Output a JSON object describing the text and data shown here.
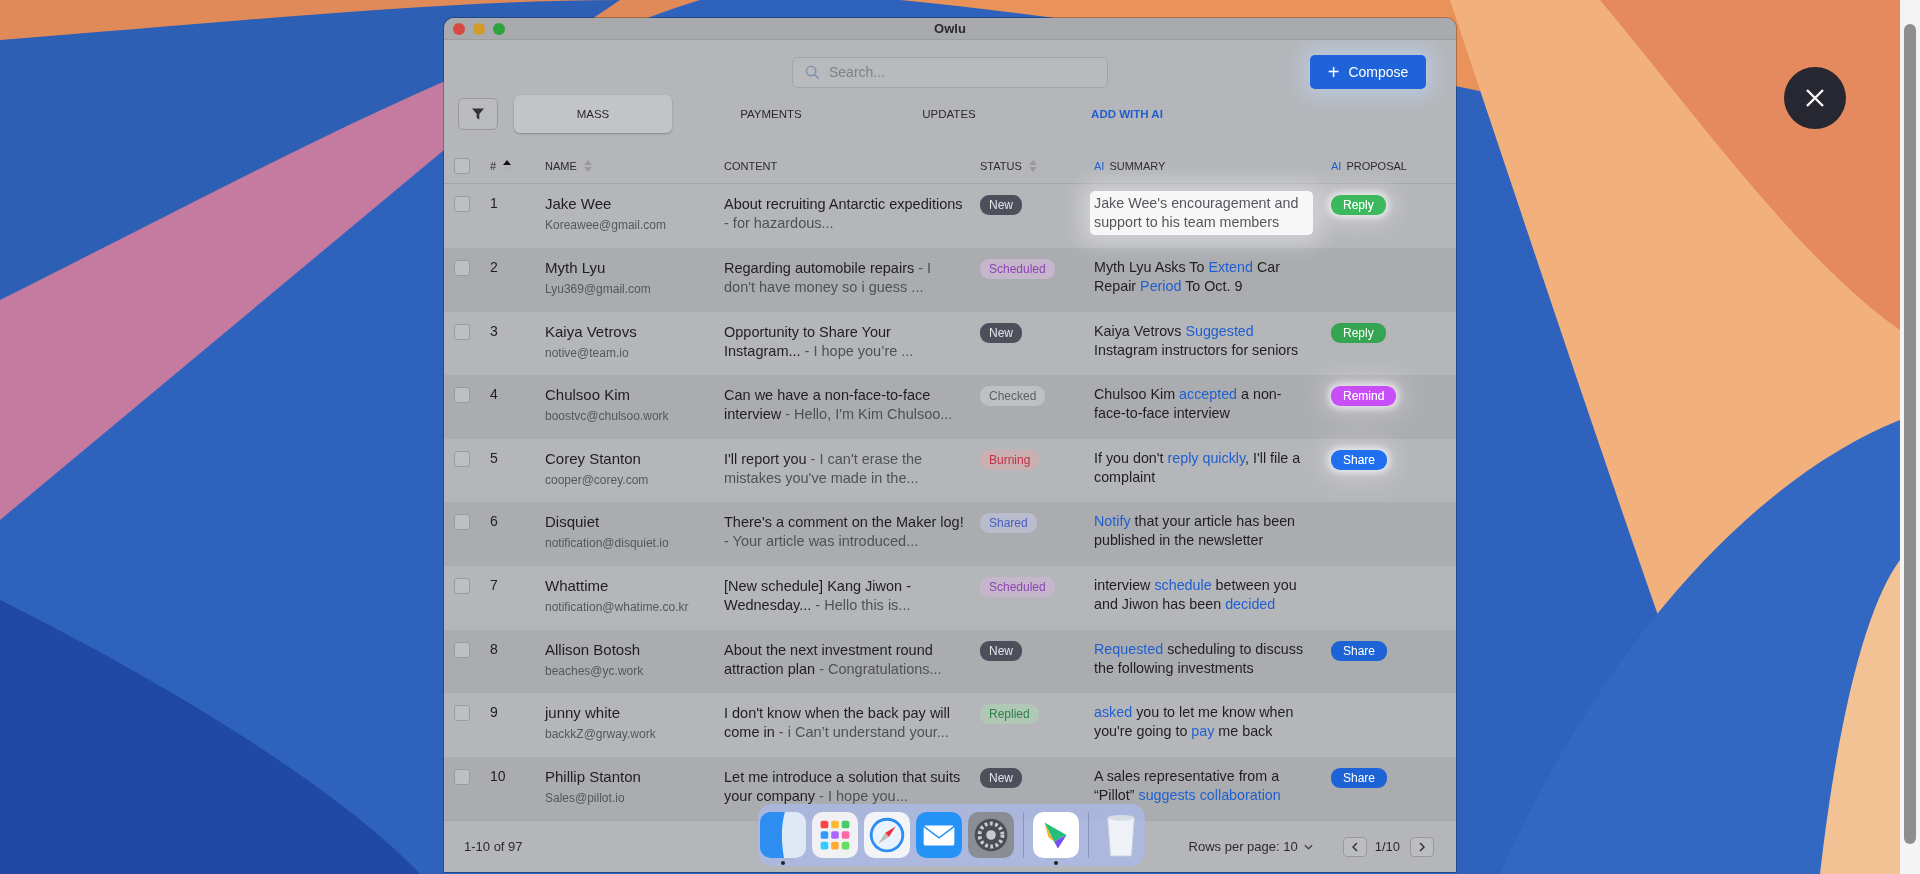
{
  "window": {
    "title": "Owlu"
  },
  "search": {
    "placeholder": "Search..."
  },
  "compose_button": {
    "icon": "+",
    "label": "Compose"
  },
  "tabs": [
    {
      "label": "MASS",
      "selected": true,
      "kind": "tab"
    },
    {
      "label": "PAYMENTS",
      "selected": false,
      "kind": "tab"
    },
    {
      "label": "UPDATES",
      "selected": false,
      "kind": "tab"
    },
    {
      "label": "ADD WITH AI",
      "selected": false,
      "kind": "action"
    }
  ],
  "table": {
    "select_all": {
      "checked": false
    },
    "columns": [
      {
        "label": "#",
        "sortable": true,
        "sorted_ascending": true
      },
      {
        "label": "NAME",
        "sortable": true,
        "sorted_ascending": false
      },
      {
        "label": "CONTENT",
        "sortable": false
      },
      {
        "label": "STATUS",
        "sortable": true,
        "sorted_ascending": false
      },
      {
        "prefix": "AI",
        "label": "SUMMARY",
        "sortable": false
      },
      {
        "prefix": "AI",
        "label": "PROPOSAL",
        "sortable": false
      }
    ],
    "rows": [
      {
        "checked": false,
        "number": "1",
        "name": "Jake Wee",
        "email": "Koreawee@gmail.com",
        "subject": "About recruiting Antarctic expeditions",
        "preview": "- for hazardous...",
        "status": {
          "label": "New",
          "kind": "new"
        },
        "summary_highlighted": true,
        "summary": [
          {
            "text": "Jake Wee's encouragement and support to his team members",
            "highlight": false
          }
        ],
        "proposal": {
          "label": "Reply",
          "kind": "reply",
          "glow": true
        }
      },
      {
        "checked": false,
        "number": "2",
        "name": "Myth Lyu",
        "email": "Lyu369@gmail.com",
        "subject": "Regarding automobile repairs",
        "preview": "- I don't have money so i guess ...",
        "status": {
          "label": "Scheduled",
          "kind": "scheduled"
        },
        "summary_highlighted": false,
        "summary": [
          {
            "text": "Myth Lyu Asks To ",
            "highlight": false
          },
          {
            "text": "Extend",
            "highlight": true
          },
          {
            "text": " Car Repair ",
            "highlight": false
          },
          {
            "text": "Period",
            "highlight": true
          },
          {
            "text": " To Oct. 9",
            "highlight": false
          }
        ]
      },
      {
        "checked": false,
        "number": "3",
        "name": "Kaiya Vetrovs",
        "email": "notive@team.io",
        "subject": "Opportunity to Share Your Instagram...",
        "preview": "- I hope you’re ...",
        "status": {
          "label": "New",
          "kind": "new"
        },
        "summary_highlighted": false,
        "summary": [
          {
            "text": "Kaiya Vetrovs ",
            "highlight": false
          },
          {
            "text": "Suggested",
            "highlight": true
          },
          {
            "text": " Instagram instructors for seniors",
            "highlight": false
          }
        ],
        "proposal": {
          "label": "Reply",
          "kind": "reply",
          "glow": false
        }
      },
      {
        "checked": false,
        "number": "4",
        "name": "Chulsoo Kim",
        "email": "boostvc@chulsoo.work",
        "subject": "Can we have a non-face-to-face interview",
        "preview": "- Hello, I'm Kim Chulsoo...",
        "status": {
          "label": "Checked",
          "kind": "checked"
        },
        "summary_highlighted": false,
        "summary": [
          {
            "text": "Chulsoo Kim ",
            "highlight": false
          },
          {
            "text": "accepted",
            "highlight": true
          },
          {
            "text": " a non-face-to-face interview",
            "highlight": false
          }
        ],
        "proposal": {
          "label": "Remind",
          "kind": "remind",
          "glow": true
        }
      },
      {
        "checked": false,
        "number": "5",
        "name": "Corey Stanton",
        "email": "cooper@corey.com",
        "subject": "I'll report you",
        "preview": "- I can't erase the mistakes you've made in the...",
        "status": {
          "label": "Burning",
          "kind": "burning"
        },
        "summary_highlighted": false,
        "summary": [
          {
            "text": "If you don't ",
            "highlight": false
          },
          {
            "text": "reply quickly",
            "highlight": true
          },
          {
            "text": ", I'll file a complaint",
            "highlight": false
          }
        ],
        "proposal": {
          "label": "Share",
          "kind": "share",
          "glow": true
        }
      },
      {
        "checked": false,
        "number": "6",
        "name": "Disquiet",
        "email": "notification@disquiet.io",
        "subject": "There's a comment on the Maker log!",
        "preview": "- Your article was introduced...",
        "status": {
          "label": "Shared",
          "kind": "shared"
        },
        "summary_highlighted": false,
        "summary": [
          {
            "text": "Notify",
            "highlight": true
          },
          {
            "text": " that your article has been published in the newsletter",
            "highlight": false
          }
        ]
      },
      {
        "checked": false,
        "number": "7",
        "name": "Whattime",
        "email": "notification@whatime.co.kr",
        "subject": "[New schedule] Kang Jiwon - Wednesday...",
        "preview": " - Hello this is...",
        "status": {
          "label": "Scheduled",
          "kind": "scheduled"
        },
        "summary_highlighted": false,
        "summary": [
          {
            "text": "interview ",
            "highlight": false
          },
          {
            "text": "schedule",
            "highlight": true
          },
          {
            "text": " between you and Jiwon has been ",
            "highlight": false
          },
          {
            "text": "decided",
            "highlight": true
          }
        ]
      },
      {
        "checked": false,
        "number": "8",
        "name": "Allison Botosh",
        "email": "beaches@yc.work",
        "subject": "About the next investment round attraction plan",
        "preview": "- Congratulations...",
        "status": {
          "label": "New",
          "kind": "new"
        },
        "summary_highlighted": false,
        "summary": [
          {
            "text": "Requested",
            "highlight": true
          },
          {
            "text": " scheduling to discuss the following investments",
            "highlight": false
          }
        ],
        "proposal": {
          "label": "Share",
          "kind": "share",
          "glow": false
        }
      },
      {
        "checked": false,
        "number": "9",
        "name": "junny white",
        "email": "backkZ@grway.work",
        "subject": "I don't know when the back pay will come in",
        "preview": "- i Can’t understand your...",
        "status": {
          "label": "Replied",
          "kind": "replied"
        },
        "summary_highlighted": false,
        "summary": [
          {
            "text": "asked",
            "highlight": true
          },
          {
            "text": " you to let me know when you're going to ",
            "highlight": false
          },
          {
            "text": "pay",
            "highlight": true
          },
          {
            "text": " me back",
            "highlight": false
          }
        ]
      },
      {
        "checked": false,
        "number": "10",
        "name": "Phillip Stanton",
        "email": "Sales@pillot.io",
        "subject": "Let me introduce a solution that suits your company",
        "preview": "- I hope you...",
        "status": {
          "label": "New",
          "kind": "new"
        },
        "summary_highlighted": false,
        "summary": [
          {
            "text": "A sales representative from a “Pillot” ",
            "highlight": false
          },
          {
            "text": "suggests collaboration",
            "highlight": true
          }
        ],
        "proposal": {
          "label": "Share",
          "kind": "share",
          "glow": false
        }
      }
    ]
  },
  "footer": {
    "range": "1-10 of 97",
    "rows_per_page": "Rows per page: 10",
    "page": "1/10"
  },
  "dock": [
    {
      "kind": "finder",
      "running": true
    },
    {
      "kind": "launchpad",
      "running": false
    },
    {
      "kind": "safari",
      "running": false
    },
    {
      "kind": "mail",
      "running": false
    },
    {
      "kind": "settings",
      "running": false
    },
    {
      "kind": "app",
      "running": true
    },
    {
      "kind": "trash",
      "running": false
    }
  ]
}
